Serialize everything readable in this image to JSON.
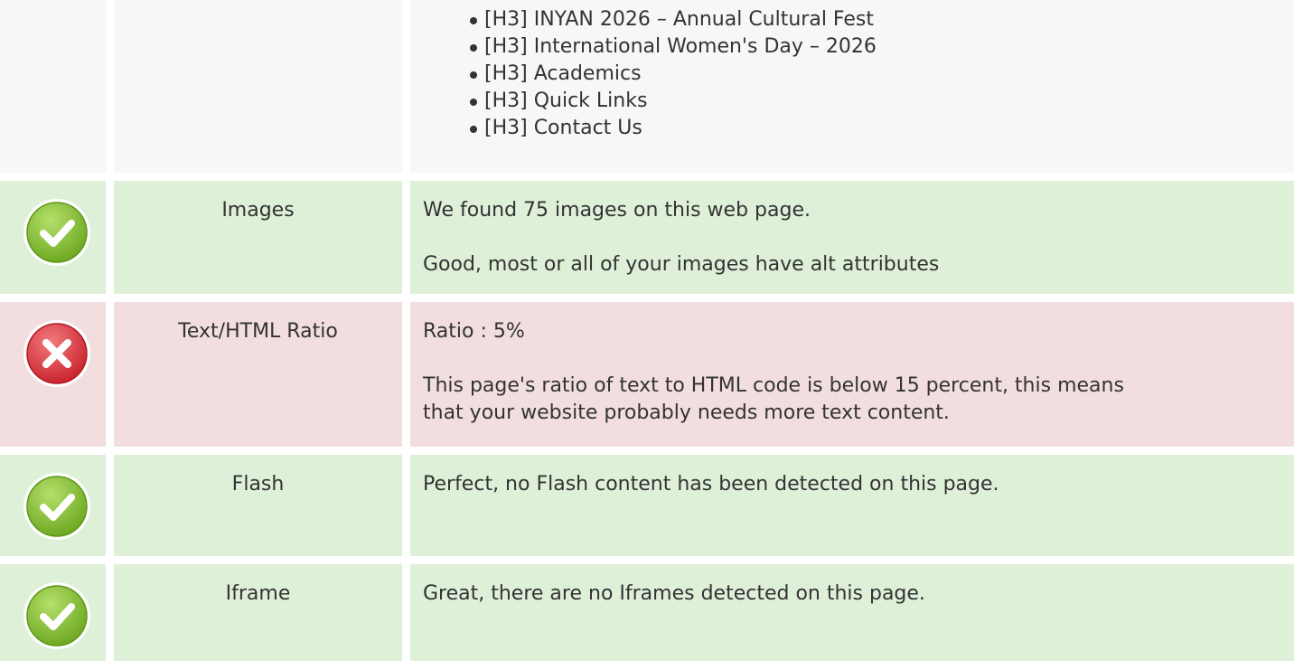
{
  "colors": {
    "pass_bg": "#dff0d8",
    "fail_bg": "#f2dede",
    "neutral_bg": "#f7f7f7",
    "pass_icon": "#8cc63f",
    "fail_icon": "#e0343b"
  },
  "headings_row": {
    "items": [
      "[H3] INYAN 2026 – Annual Cultural Fest",
      "[H3] International Women's Day – 2026",
      "[H3] Academics",
      "[H3] Quick Links",
      "[H3] Contact Us"
    ]
  },
  "rows": [
    {
      "status": "pass",
      "icon": "check-circle-icon",
      "label": "Images",
      "lines": [
        "We found 75 images on this web page.",
        "Good, most or all of your images have alt attributes"
      ]
    },
    {
      "status": "fail",
      "icon": "cross-circle-icon",
      "label": "Text/HTML Ratio",
      "lines": [
        "Ratio : 5%",
        "This page's ratio of text to HTML code is below 15 percent, this means",
        "that your website probably needs more text content."
      ]
    },
    {
      "status": "pass",
      "icon": "check-circle-icon",
      "label": "Flash",
      "lines": [
        "Perfect, no Flash content has been detected on this page."
      ]
    },
    {
      "status": "pass",
      "icon": "check-circle-icon",
      "label": "Iframe",
      "lines": [
        "Great, there are no Iframes detected on this page."
      ]
    }
  ]
}
